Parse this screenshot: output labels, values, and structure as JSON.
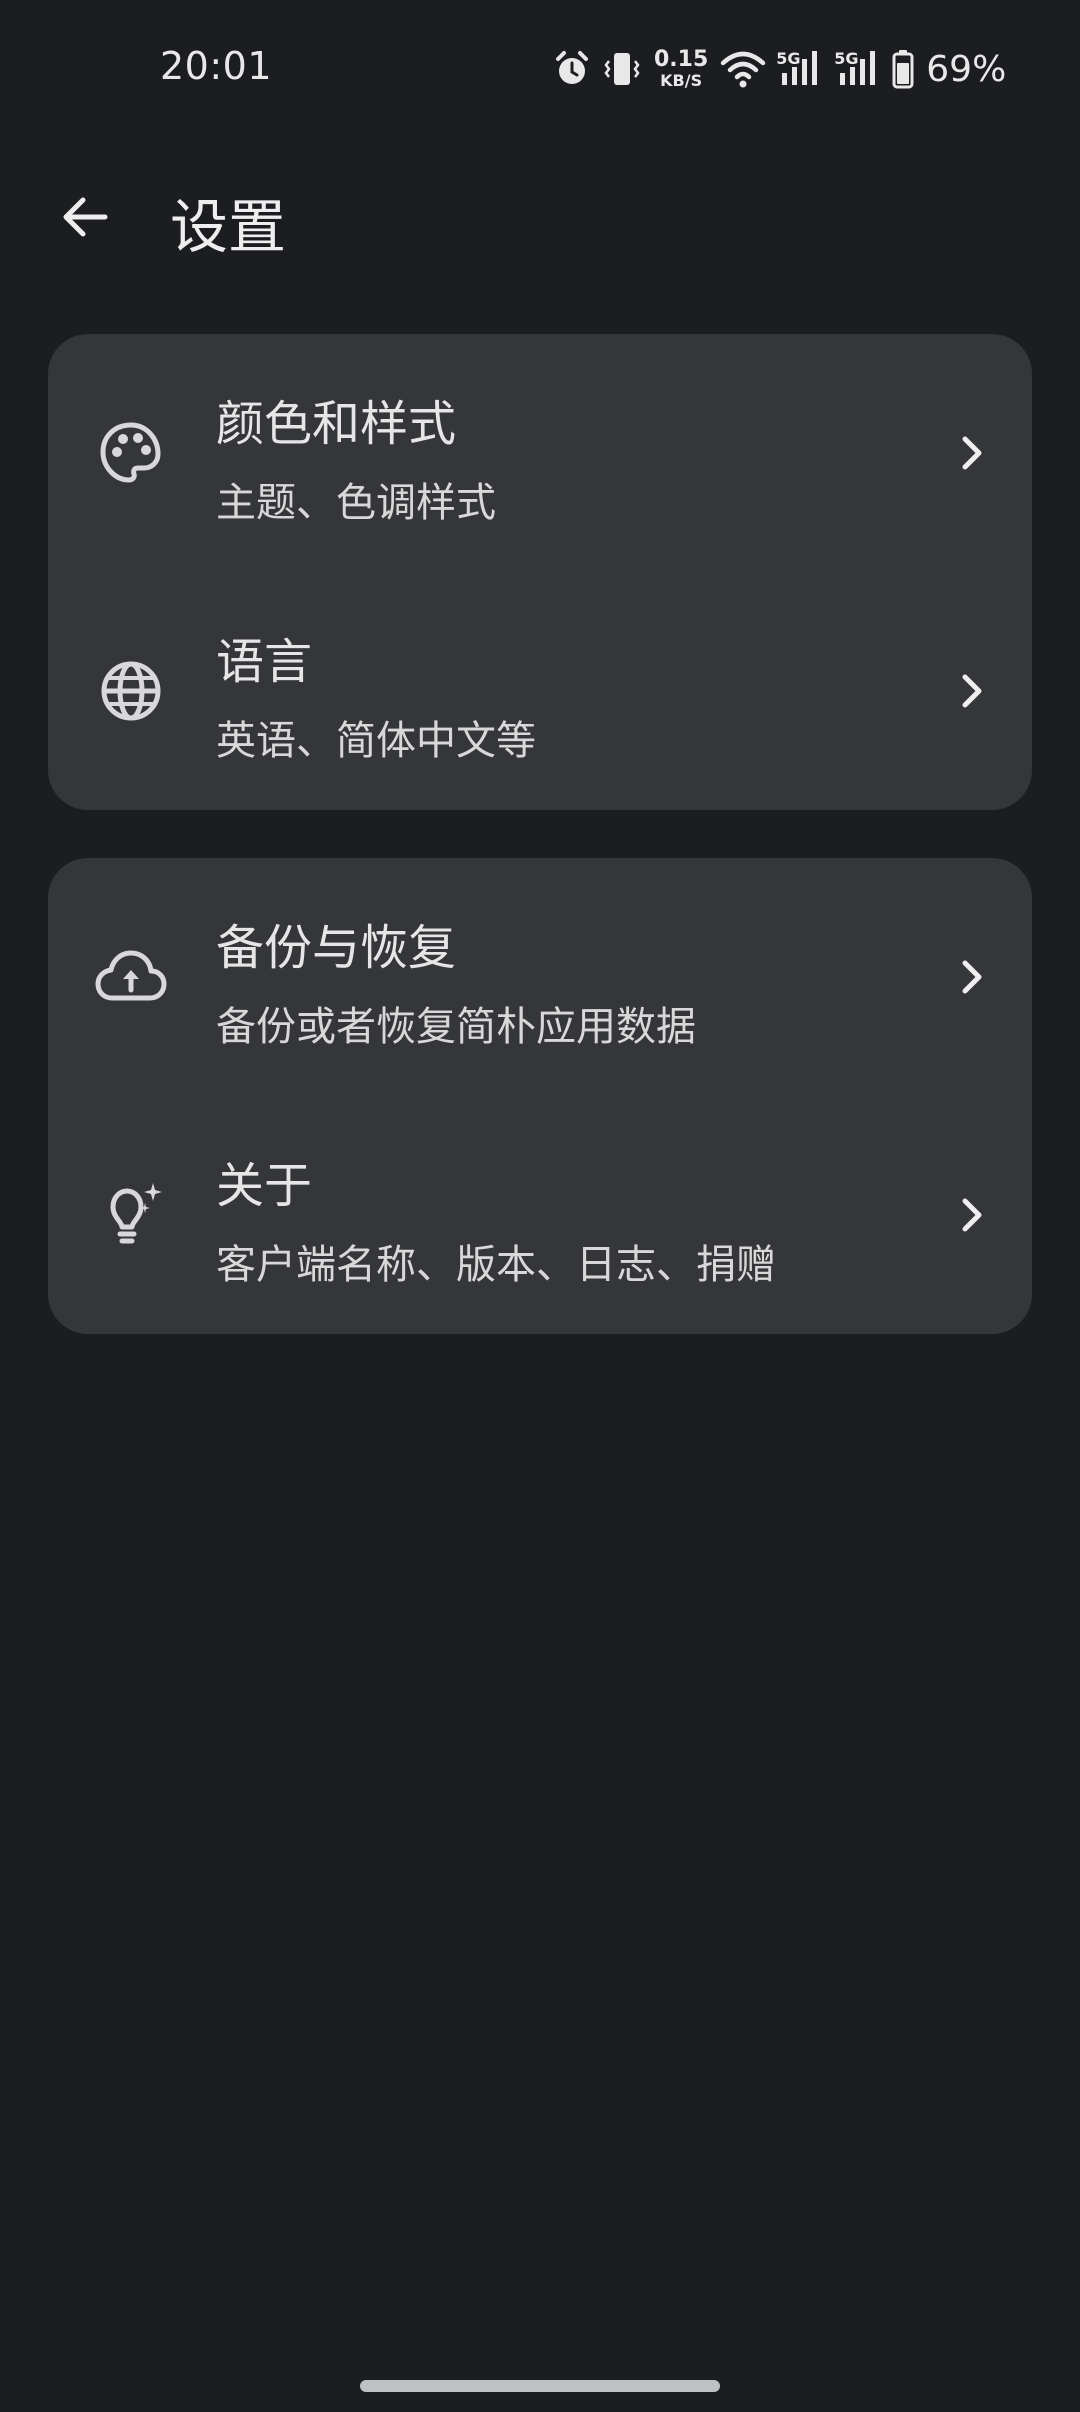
{
  "status_bar": {
    "time": "20:01",
    "net_speed_value": "0.15",
    "net_speed_unit": "KB/S",
    "sim1_tag": "5G",
    "sim2_tag": "5G",
    "battery_percent": "69%"
  },
  "app_bar": {
    "title": "设置",
    "back_icon": "arrow-back-icon"
  },
  "sections": [
    {
      "items": [
        {
          "title": "颜色和样式",
          "subtitle": "主题、色调样式",
          "icon": "palette-icon"
        },
        {
          "title": "语言",
          "subtitle": "英语、简体中文等",
          "icon": "globe-icon"
        }
      ]
    },
    {
      "items": [
        {
          "title": "备份与恢复",
          "subtitle": "备份或者恢复简朴应用数据",
          "icon": "cloud-upload-icon"
        },
        {
          "title": "关于",
          "subtitle": "客户端名称、版本、日志、捐赠",
          "icon": "lightbulb-sparkle-icon"
        }
      ]
    }
  ],
  "colors": {
    "background": "#1b1d20",
    "card": "#353639",
    "text_primary": "#e6e6e6"
  }
}
